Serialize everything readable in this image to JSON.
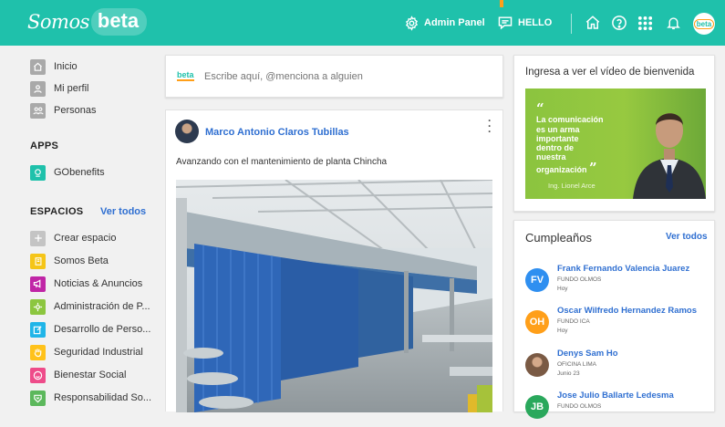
{
  "header": {
    "logo_script": "Somos",
    "logo_beta": "beta",
    "admin_panel": "Admin Panel",
    "hello": "HELLO",
    "avatar_label": "beta",
    "brand_color": "#1fc1ab",
    "accent_color": "#ff9f19"
  },
  "sidebar": {
    "nav": [
      {
        "label": "Inicio",
        "icon": "home-icon"
      },
      {
        "label": "Mi perfil",
        "icon": "user-icon"
      },
      {
        "label": "Personas",
        "icon": "people-icon"
      }
    ],
    "apps_title": "APPS",
    "apps": [
      {
        "label": "GObenefits",
        "icon": "gobenefits-icon"
      }
    ],
    "spaces_title": "ESPACIOS",
    "spaces_see_all": "Ver todos",
    "spaces": [
      {
        "label": "Crear espacio",
        "icon": "plus-icon",
        "color": "#c4c4c4"
      },
      {
        "label": "Somos Beta",
        "icon": "document-icon",
        "color": "#f5c518"
      },
      {
        "label": "Noticias & Anuncios",
        "icon": "megaphone-icon",
        "color": "#c026a6"
      },
      {
        "label": "Administración de P...",
        "icon": "gear-group-icon",
        "color": "#8cc63f"
      },
      {
        "label": "Desarrollo de Perso...",
        "icon": "edit-icon",
        "color": "#20b5e8"
      },
      {
        "label": "Seguridad Industrial",
        "icon": "hand-icon",
        "color": "#ffc21a"
      },
      {
        "label": "Bienestar Social",
        "icon": "smile-icon",
        "color": "#ee4c8a"
      },
      {
        "label": "Responsabilidad So...",
        "icon": "handshake-icon",
        "color": "#5cb85c"
      }
    ]
  },
  "composer": {
    "logo": "beta",
    "placeholder": "Escribe aquí, @menciona a alguien"
  },
  "post": {
    "author": "Marco Antonio Claros Tubillas",
    "text": "Avanzando con el mantenimiento de planta Chincha"
  },
  "welcome": {
    "title": "Ingresa a ver el vídeo de bienvenida",
    "quote_lines": [
      "La comunicación",
      "es un arma",
      "importante",
      "dentro de",
      "nuestra",
      "organización"
    ],
    "signature": "Ing. Lionel Arce"
  },
  "birthdays": {
    "title": "Cumpleaños",
    "see_all": "Ver todos",
    "people": [
      {
        "initials": "FV",
        "name": "Frank Fernando Valencia Juarez",
        "org": "FUNDO OLMOS",
        "when": "Hoy",
        "color": "#2f8ff0"
      },
      {
        "initials": "OH",
        "name": "Oscar Wilfredo Hernandez Ramos",
        "org": "FUNDO ICA",
        "when": "Hoy",
        "color": "#ff9f19"
      },
      {
        "initials": "",
        "name": "Denys Sam Ho",
        "org": "OFICINA LIMA",
        "when": "Junio 23",
        "color": "#7a5a44"
      },
      {
        "initials": "JB",
        "name": "Jose Julio Ballarte Ledesma",
        "org": "FUNDO OLMOS",
        "when": "",
        "color": "#2aa85c"
      }
    ]
  }
}
